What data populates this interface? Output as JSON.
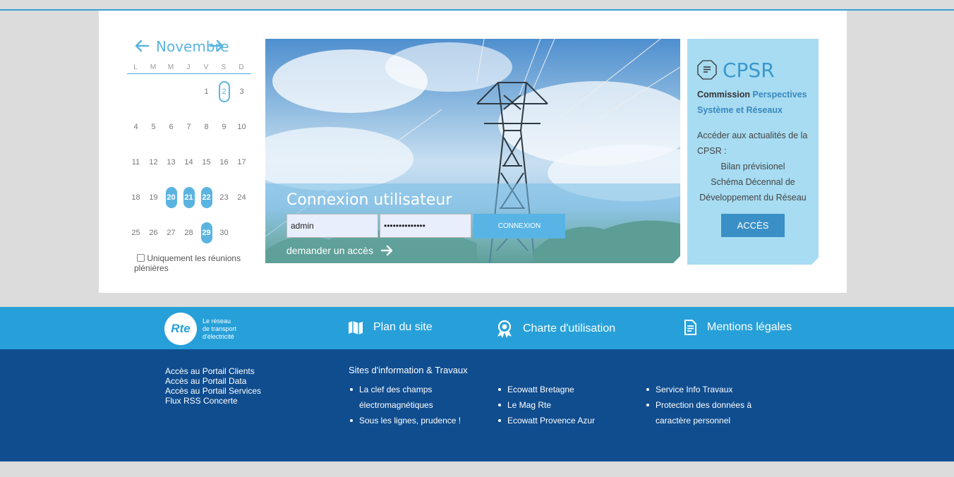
{
  "calendar": {
    "month": "Novembre",
    "weekdays": [
      "L",
      "M",
      "M",
      "J",
      "V",
      "S",
      "D"
    ],
    "weeks": [
      [
        "",
        "",
        "",
        "",
        "1",
        "2",
        "3"
      ],
      [
        "4",
        "5",
        "6",
        "7",
        "8",
        "9",
        "10"
      ],
      [
        "11",
        "12",
        "13",
        "14",
        "15",
        "16",
        "17"
      ],
      [
        "18",
        "19",
        "20",
        "21",
        "22",
        "23",
        "24"
      ],
      [
        "25",
        "26",
        "27",
        "28",
        "29",
        "30",
        ""
      ]
    ],
    "today": "2",
    "meeting_days": [
      "20",
      "21",
      "22",
      "29"
    ],
    "filter_label": "Uniquement les réunions plénières",
    "accent_color": "#5bb4e0"
  },
  "login": {
    "title": "Connexion utilisateur",
    "username_value": "admin",
    "password_value": "••••••••••••••",
    "submit_label": "CONNEXION",
    "request_access_label": "demander un accès"
  },
  "cpsr": {
    "title": "CPSR",
    "subtitle_bold": "Commission",
    "subtitle_highlight": "Perspectives Système et Réseaux",
    "description": "Accéder aux actualités de la CPSR :",
    "items": [
      "Bilan prévisionel",
      "Schéma Décennal de Développement du Réseau"
    ],
    "button_label": "ACCÈS",
    "bg_color": "#a7dcf2"
  },
  "footer": {
    "logo_mark": "Rte",
    "logo_lines": [
      "Le réseau",
      "de transport",
      "d'électricité"
    ],
    "links": [
      "Plan du site",
      "Charte d'utilisation",
      "Mentions légales"
    ],
    "portal_links": [
      "Accès au Portail Clients",
      "Accès au Portail Data",
      "Accès au Portail Services",
      "Flux RSS Concerte"
    ],
    "sites_title": "Sites d'information & Travaux",
    "sites_col1": [
      "La clef des champs électromagnétiques",
      "Sous les lignes, prudence !"
    ],
    "sites_col2": [
      "Ecowatt Bretagne",
      "Le Mag Rte",
      "Ecowatt Provence Azur"
    ],
    "sites_col3": [
      "Service Info Travaux",
      "Protection des données à caractère personnel"
    ],
    "bar_color": "#27a0d9",
    "bottom_color": "#0f4d8f"
  }
}
